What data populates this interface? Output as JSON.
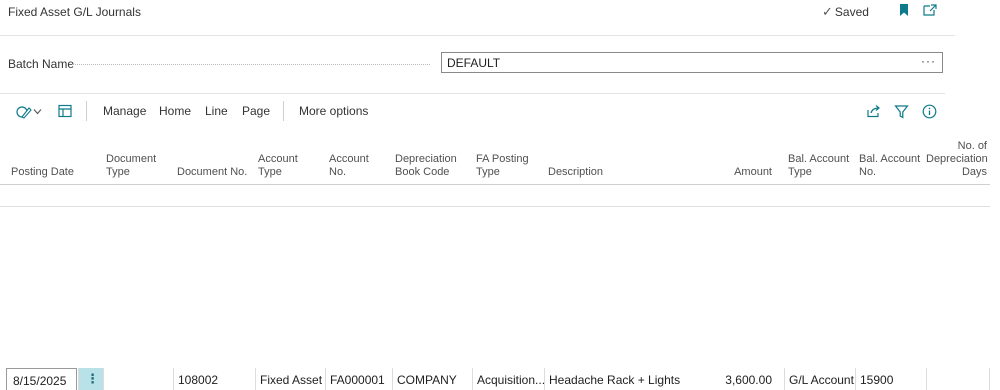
{
  "page": {
    "title": "Fixed Asset G/L Journals",
    "saved_label": "Saved"
  },
  "batch": {
    "label": "Batch Name",
    "value": "DEFAULT",
    "ellipsis": "···"
  },
  "actions": {
    "manage": "Manage",
    "home": "Home",
    "line": "Line",
    "page": "Page",
    "more": "More options"
  },
  "icons": {
    "saved": "check-icon",
    "bookmark": "bookmark-icon",
    "popout": "popout-icon",
    "edit": "edit-list-icon",
    "chevron": "chevron-down-icon",
    "view": "list-view-icon",
    "share": "share-icon",
    "filter": "filter-icon",
    "info": "info-icon"
  },
  "grid": {
    "headers": {
      "posting_date": "Posting Date",
      "document_type_1": "Document",
      "document_type_2": "Type",
      "document_no": "Document No.",
      "account_type_1": "Account",
      "account_type_2": "Type",
      "account_no_1": "Account",
      "account_no_2": "No.",
      "depr_book_1": "Depreciation",
      "depr_book_2": "Book Code",
      "fa_posting_1": "FA Posting",
      "fa_posting_2": "Type",
      "description": "Description",
      "amount": "Amount",
      "bal_type_1": "Bal. Account",
      "bal_type_2": "Type",
      "bal_no_1": "Bal. Account",
      "bal_no_2": "No.",
      "no_days_1": "No. of",
      "no_days_2": "Depreciation",
      "no_days_3": "Days"
    },
    "row": {
      "posting_date": "8/15/2025",
      "row_menu": "⋮",
      "document_type": "",
      "document_no": "108002",
      "account_type": "Fixed Asset",
      "account_no": "FA000001",
      "depr_book_code": "COMPANY",
      "fa_posting_type": "Acquisition...",
      "description": "Headache Rack + Lights",
      "amount": "3,600.00",
      "bal_account_type": "G/L Account",
      "bal_account_no": "15900",
      "no_depr_days": ""
    }
  },
  "colors": {
    "accent": "#0e7a8a",
    "row_menu_bg": "#b8e2e8"
  }
}
